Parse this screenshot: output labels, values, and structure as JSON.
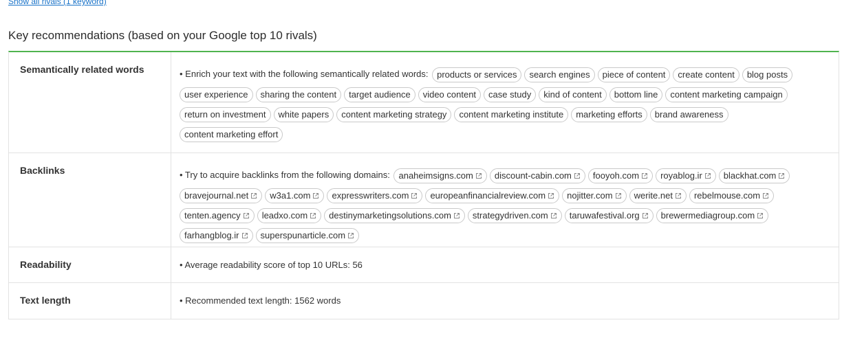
{
  "top_link": "Show all rivals (1 keyword)",
  "section_title": "Key recommendations (based on your Google top 10 rivals)",
  "rows": {
    "semantic": {
      "label": "Semantically related words",
      "intro": "• Enrich your text with the following semantically related words:",
      "chips": [
        "products or services",
        "search engines",
        "piece of content",
        "create content",
        "blog posts",
        "user experience",
        "sharing the content",
        "target audience",
        "video content",
        "case study",
        "kind of content",
        "bottom line",
        "content marketing campaign",
        "return on investment",
        "white papers",
        "content marketing strategy",
        "content marketing institute",
        "marketing efforts",
        "brand awareness",
        "content marketing effort"
      ]
    },
    "backlinks": {
      "label": "Backlinks",
      "intro": "• Try to acquire backlinks from the following domains:",
      "chips": [
        "anaheimsigns.com",
        "discount-cabin.com",
        "fooyoh.com",
        "royablog.ir",
        "blackhat.com",
        "bravejournal.net",
        "w3a1.com",
        "expresswriters.com",
        "europeanfinancialreview.com",
        "nojitter.com",
        "werite.net",
        "rebelmouse.com",
        "tenten.agency",
        "leadxo.com",
        "destinymarketingsolutions.com",
        "strategydriven.com",
        "taruwafestival.org",
        "brewermediagroup.com",
        "farhangblog.ir",
        "superspunarticle.com"
      ]
    },
    "readability": {
      "label": "Readability",
      "text": "• Average readability score of top 10 URLs: 56"
    },
    "text_length": {
      "label": "Text length",
      "text": "• Recommended text length: 1562 words"
    }
  },
  "icons": {
    "external": "external-link-icon"
  },
  "colors": {
    "accent_border": "#4fb34e",
    "link": "#1a73c8"
  }
}
